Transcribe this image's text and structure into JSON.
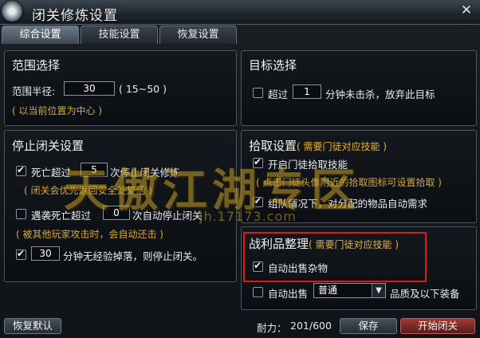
{
  "window": {
    "title": "闭关修炼设置"
  },
  "tabs": [
    {
      "label": "综合设置",
      "active": true
    },
    {
      "label": "技能设置",
      "active": false
    },
    {
      "label": "恢复设置",
      "active": false
    }
  ],
  "range": {
    "title": "范围选择",
    "radius_label": "范围半径:",
    "radius_value": "30",
    "radius_hint": "( 15~50 )",
    "center_note": "( 以当前位置为中心 )"
  },
  "target": {
    "title": "目标选择",
    "prefix": "超过",
    "minutes": "1",
    "suffix": "分钟未击杀，放弃此目标",
    "checked": false
  },
  "stop": {
    "title": "停止闭关设置",
    "death": {
      "checked": true,
      "prefix": "死亡超过",
      "value": "5",
      "suffix": "次停止闭关修炼",
      "note": "( 闭关会优先返回安全处复活 )"
    },
    "ambush": {
      "checked": false,
      "prefix": "遇袭死亡超过",
      "value": "0",
      "suffix": "次自动停止闭关",
      "note": "( 被其他玩家攻击时，会自动还击 )"
    },
    "noexp": {
      "checked": true,
      "value": "30",
      "suffix": "分钟无经验掉落，则停止闭关。"
    }
  },
  "pickup": {
    "title": "拾取设置",
    "title_note": "( 需要门徒对应技能 )",
    "auto_pick": {
      "checked": true,
      "label": "开启门徒拾取技能"
    },
    "hint": "( 点击门徒头像附近的拾取图标可设置拾取 )",
    "team": {
      "checked": true,
      "label": "组队情况下，对分配的物品自动需求"
    }
  },
  "loot": {
    "title": "战利品整理",
    "title_note": "( 需要门徒对应技能 )",
    "sell_junk": {
      "checked": true,
      "label": "自动出售杂物"
    },
    "sell_equip": {
      "checked": false,
      "label": "自动出售",
      "quality": "普通",
      "suffix": "品质及以下装备"
    }
  },
  "footer": {
    "reset_label": "恢复默认",
    "durability_label": "耐力：",
    "durability_value": "201/600",
    "save_label": "保存",
    "start_label": "开始闭关"
  },
  "watermark": {
    "text": "天傲江湖专区",
    "sub": "jh.17173.com"
  }
}
